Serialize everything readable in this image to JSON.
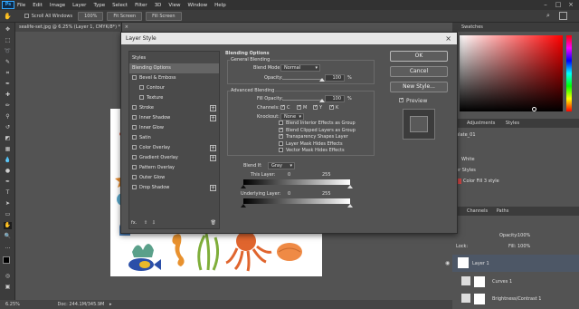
{
  "menubar": {
    "logo": "Ps",
    "items": [
      "File",
      "Edit",
      "Image",
      "Layer",
      "Type",
      "Select",
      "Filter",
      "3D",
      "View",
      "Window",
      "Help"
    ]
  },
  "optionsbar": {
    "scroll_all": "Scroll All Windows",
    "zoom": "100%",
    "fit_screen": "Fit Screen",
    "fill_screen": "Fill Screen"
  },
  "document": {
    "tab_title": "sealife-set.jpg @ 6.25% (Layer 1, CMYK/8*) *",
    "zoom": "6.25%",
    "doc_size": "Doc: 244.1M/345.9M"
  },
  "right_panel": {
    "swatches_tab": "Swatches",
    "adjustments_tab": "Adjustments",
    "styles_tab": "Styles",
    "preset_label": "plate_01",
    "white_label": "White",
    "layer_styles_label": "er Styles",
    "color_fill_label": "Color Fill 3 style",
    "channels_tab": "Channels",
    "paths_tab": "Paths",
    "opacity_label": "Opacity:",
    "opacity_value": "100%",
    "fill_label": "Fill:",
    "fill_value": "100%",
    "lock_label": "Lock:",
    "layer1": "Layer 1",
    "curves": "Curves 1",
    "brightness": "Brightness/Contrast 1"
  },
  "dialog": {
    "title": "Layer Style",
    "styles_header": "Styles",
    "style_items": [
      {
        "label": "Blending Options",
        "checkbox": false,
        "plus": false,
        "active": true
      },
      {
        "label": "Bevel & Emboss",
        "checkbox": true,
        "plus": false
      },
      {
        "label": "Contour",
        "checkbox": true,
        "plus": false,
        "indent": true
      },
      {
        "label": "Texture",
        "checkbox": true,
        "plus": false,
        "indent": true
      },
      {
        "label": "Stroke",
        "checkbox": true,
        "plus": true
      },
      {
        "label": "Inner Shadow",
        "checkbox": true,
        "plus": true
      },
      {
        "label": "Inner Glow",
        "checkbox": true,
        "plus": false
      },
      {
        "label": "Satin",
        "checkbox": true,
        "plus": false
      },
      {
        "label": "Color Overlay",
        "checkbox": true,
        "plus": true
      },
      {
        "label": "Gradient Overlay",
        "checkbox": true,
        "plus": true
      },
      {
        "label": "Pattern Overlay",
        "checkbox": true,
        "plus": false
      },
      {
        "label": "Outer Glow",
        "checkbox": true,
        "plus": false
      },
      {
        "label": "Drop Shadow",
        "checkbox": true,
        "plus": true
      }
    ],
    "fx_label": "fx.",
    "blending_options": "Blending Options",
    "general_blending": "General Blending",
    "blend_mode_label": "Blend Mode:",
    "blend_mode_value": "Normal",
    "opacity_label": "Opacity:",
    "opacity_value": "100",
    "percent": "%",
    "advanced_blending": "Advanced Blending",
    "fill_opacity_label": "Fill Opacity:",
    "fill_opacity_value": "100",
    "channels_label": "Channels:",
    "channels": [
      "C",
      "M",
      "Y",
      "K"
    ],
    "knockout_label": "Knockout:",
    "knockout_value": "None",
    "options": [
      {
        "label": "Blend Interior Effects as Group",
        "checked": false
      },
      {
        "label": "Blend Clipped Layers as Group",
        "checked": true
      },
      {
        "label": "Transparency Shapes Layer",
        "checked": true
      },
      {
        "label": "Layer Mask Hides Effects",
        "checked": false
      },
      {
        "label": "Vector Mask Hides Effects",
        "checked": false
      }
    ],
    "blend_if_label": "Blend If:",
    "blend_if_value": "Gray",
    "this_layer_label": "This Layer:",
    "this_layer_low": "0",
    "this_layer_high": "255",
    "underlying_label": "Underlying Layer:",
    "underlying_low": "0",
    "underlying_high": "255",
    "ok": "OK",
    "cancel": "Cancel",
    "new_style": "New Style...",
    "preview_label": "Preview",
    "close": "×"
  }
}
